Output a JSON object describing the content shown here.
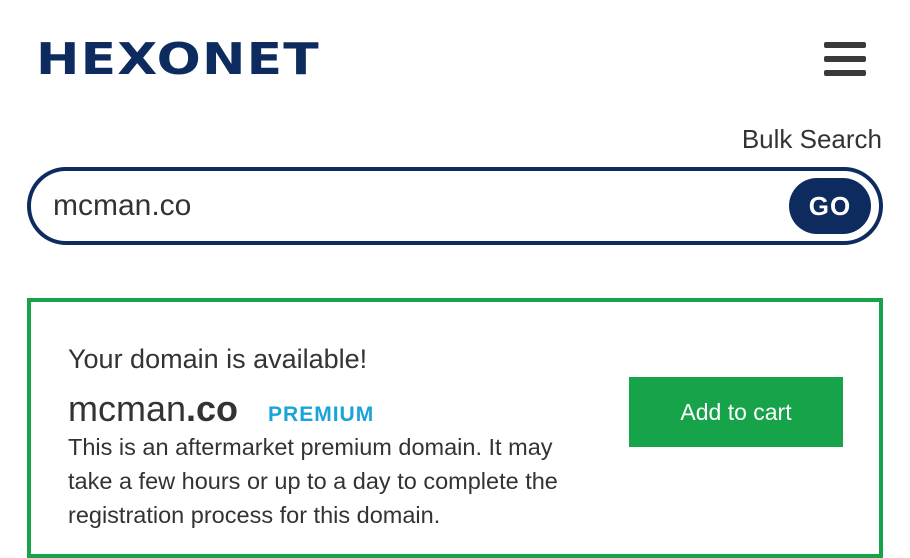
{
  "header": {
    "logo_text": "HEXONET",
    "menu_icon": "hamburger-menu-icon"
  },
  "search": {
    "bulk_search_label": "Bulk Search",
    "query_value": "mcman.co",
    "go_label": "GO"
  },
  "result": {
    "status_text": "Your domain is available!",
    "domain_name": "mcman",
    "domain_tld": ".co",
    "badge": "PREMIUM",
    "description": "This is an aftermarket premium domain. It may take a few hours or up to a day to complete the registration process for this domain.",
    "add_to_cart_label": "Add to cart"
  },
  "colors": {
    "brand_navy": "#0d2b5e",
    "success_green": "#16a34a",
    "premium_blue": "#1aa3d9",
    "text": "#333333"
  }
}
